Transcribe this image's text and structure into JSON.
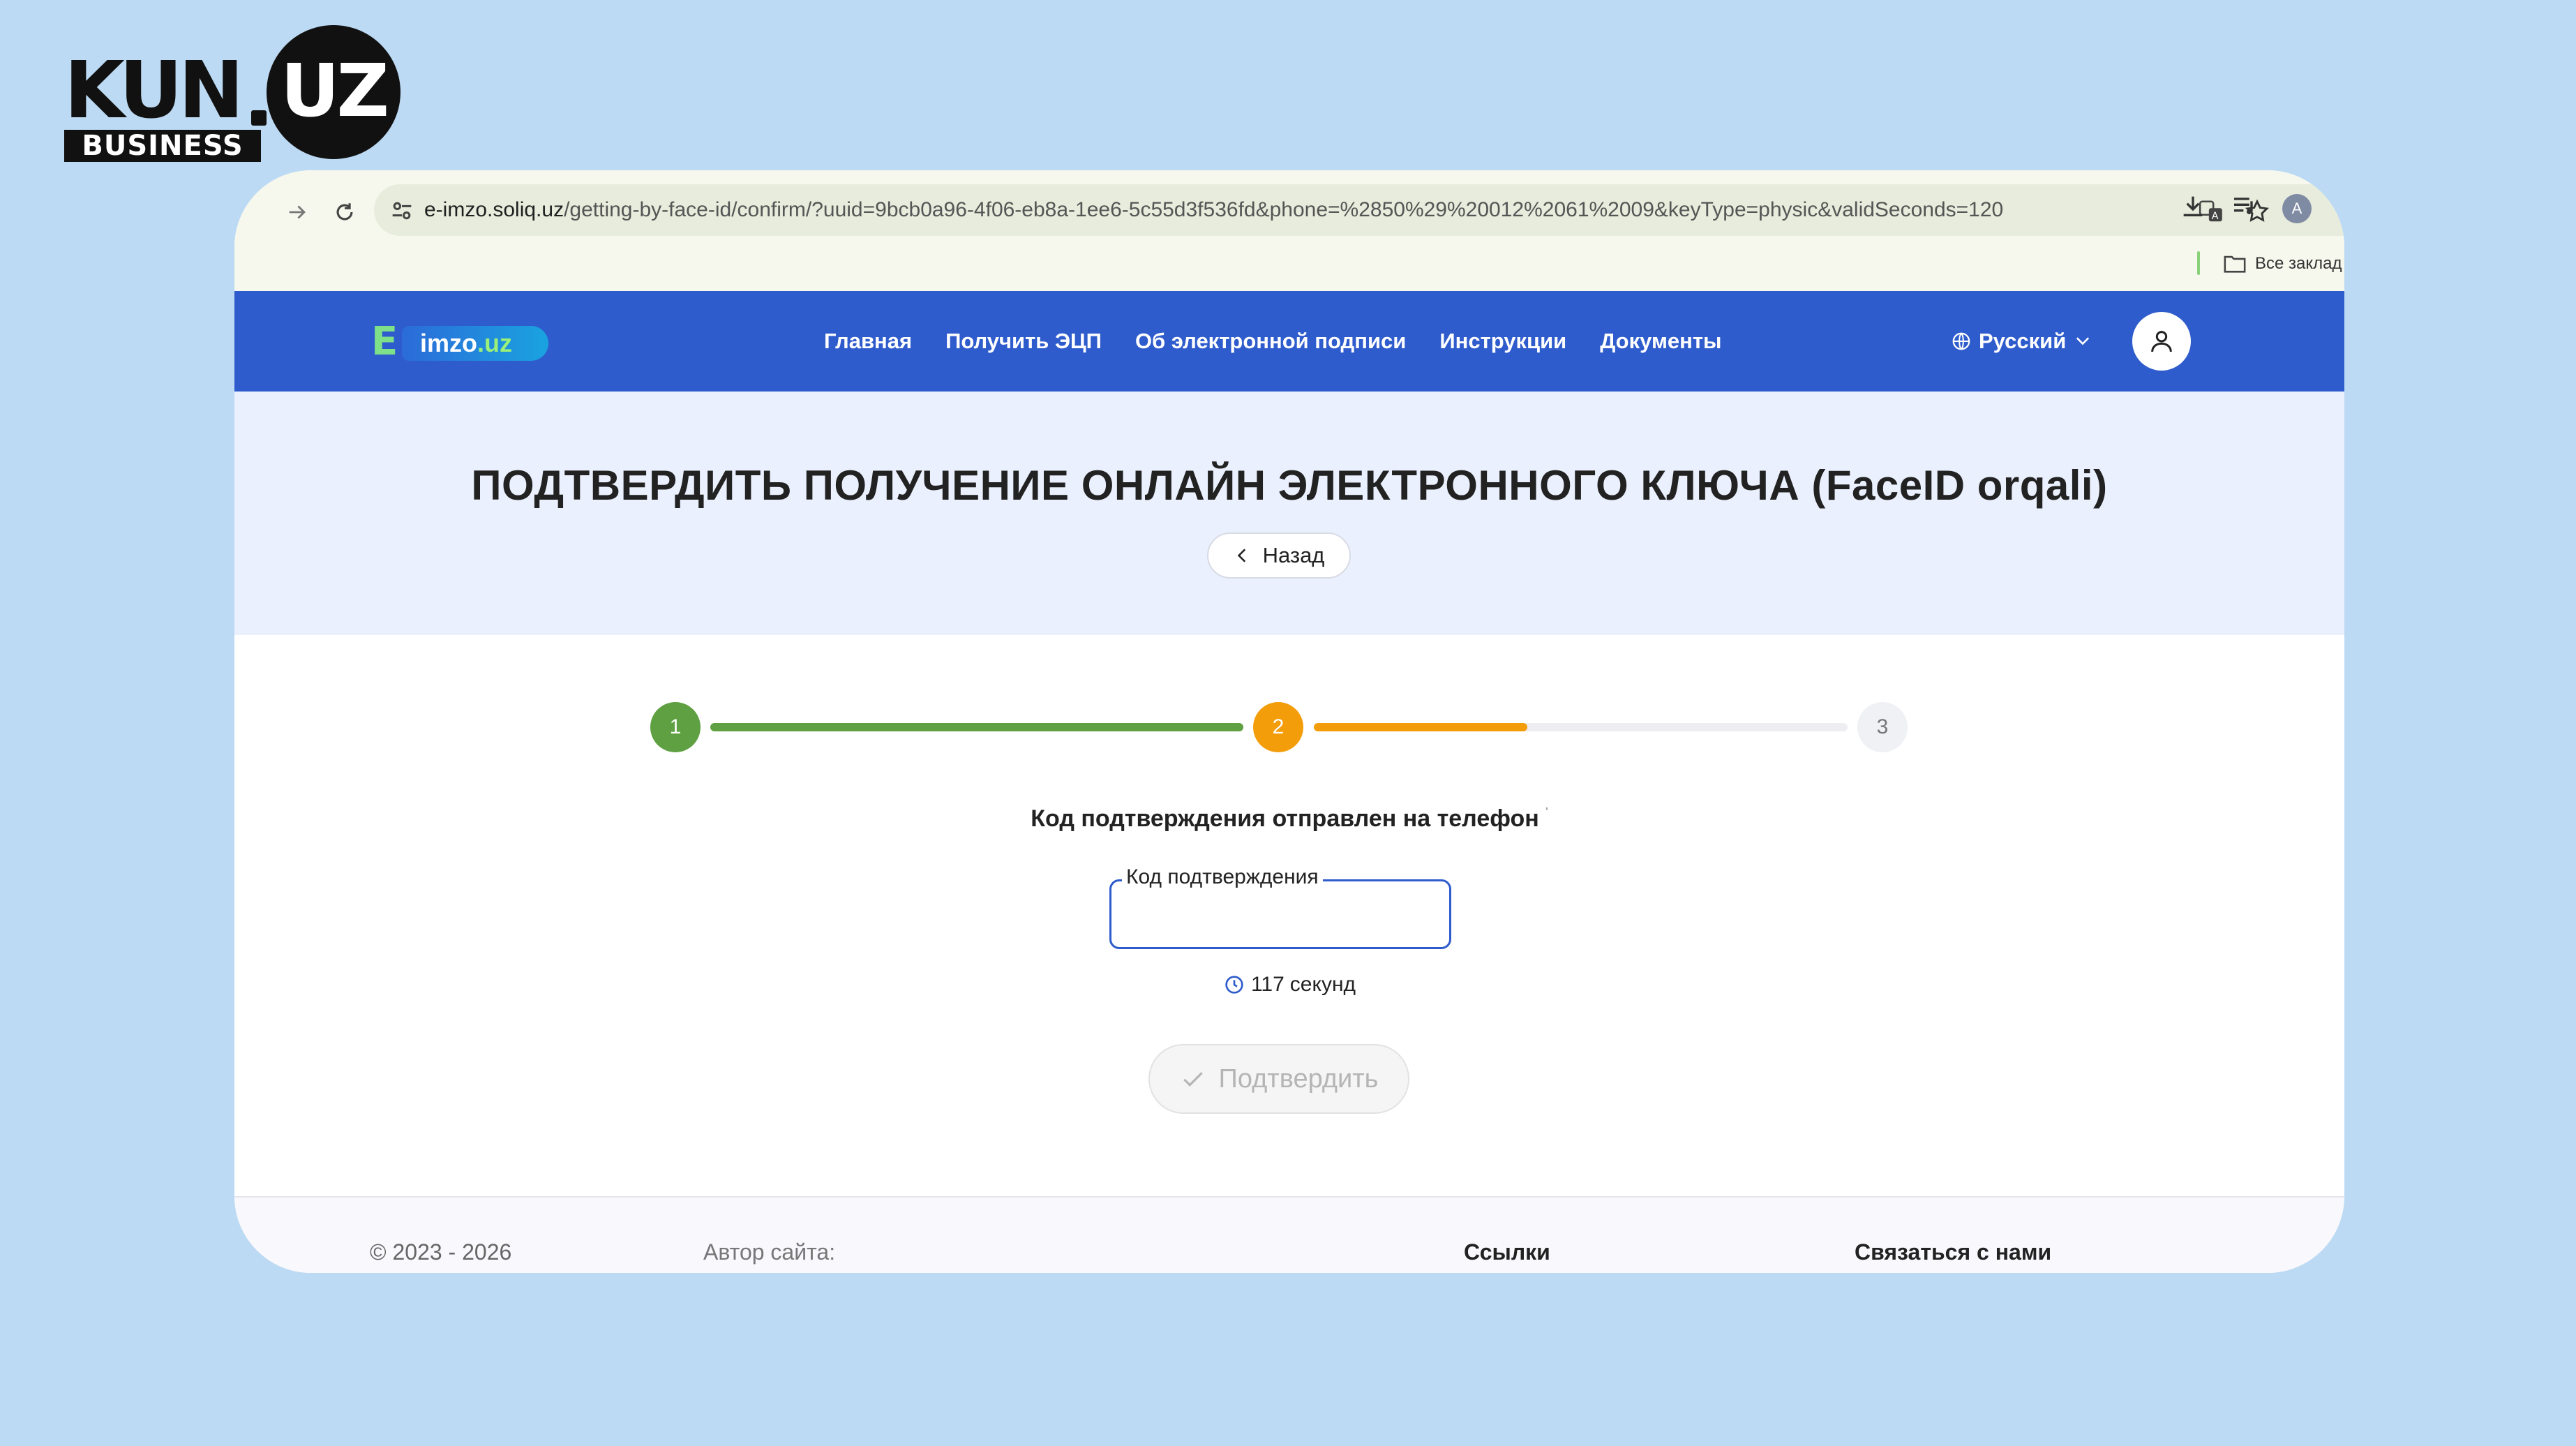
{
  "brand": {
    "kun": "KUN",
    "uz": "UZ",
    "business": "BUSINESS"
  },
  "browser": {
    "url_host": "e-imzo.soliq.uz",
    "url_path": "/getting-by-face-id/confirm/?uuid=9bcb0a96-4f06-eb8a-1ee6-5c55d3f536fd&phone=%2850%29%20012%2061%2009&keyType=physic&validSeconds=120",
    "profile_initial": "A",
    "bookmarks_label": "Все заклад"
  },
  "site": {
    "logo_e": "E",
    "logo_text": "imzo",
    "logo_tld": ".uz",
    "nav": [
      {
        "label": "Главная"
      },
      {
        "label": "Получить ЭЦП"
      },
      {
        "label": "Об электронной подписи"
      },
      {
        "label": "Инструкции"
      },
      {
        "label": "Документы"
      }
    ],
    "language": "Русский"
  },
  "hero": {
    "title": "ПОДТВЕРДИТЬ ПОЛУЧЕНИЕ ОНЛАЙН ЭЛЕКТРОННОГО КЛЮЧА (FaceID orqali)",
    "back_label": "Назад"
  },
  "stepper": {
    "steps": [
      "1",
      "2",
      "3"
    ],
    "current_step": 2,
    "segment_1_progress": 1.0,
    "segment_2_progress": 0.4,
    "colors": {
      "done": "#5fa042",
      "active": "#f39d0a",
      "pending": "#f0f1f5"
    }
  },
  "form": {
    "info": "Код подтверждения отправлен на телефон",
    "info_suffix": "'",
    "code_label": "Код подтверждения",
    "code_value": "",
    "timer_value": "117",
    "timer_unit": "секунд",
    "confirm_label": "Подтвердить"
  },
  "footer": {
    "copyright": "© 2023 - 2026",
    "author": "Автор сайта:",
    "links_title": "Ссылки",
    "contact_title": "Связаться с нами"
  },
  "colors": {
    "background": "#bcdaf3",
    "header": "#2f5ccc",
    "hero": "#eaf0fd"
  }
}
